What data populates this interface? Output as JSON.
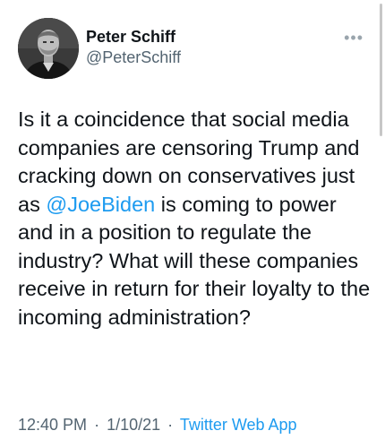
{
  "author": {
    "display_name": "Peter Schiff",
    "handle": "@PeterSchiff"
  },
  "tweet": {
    "text_before": "Is it a coincidence that social media companies are censoring Trump and cracking down on conservatives just as ",
    "mention": "@JoeBiden",
    "text_after": " is coming to power and in a position to regulate the industry? What will these companies receive in return for their loyalty to the incoming administration?"
  },
  "meta": {
    "time": "12:40 PM",
    "separator1": "·",
    "date": "1/10/21",
    "separator2": "·",
    "source": "Twitter Web App"
  },
  "icons": {
    "more": "more-icon",
    "avatar": "profile-photo"
  },
  "colors": {
    "link": "#1d9bf0",
    "secondary_text": "#536471",
    "primary_text": "#0f1419"
  }
}
